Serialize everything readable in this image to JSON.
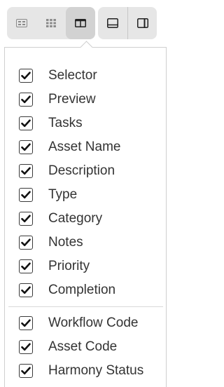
{
  "toolbar": {
    "view_buttons": [
      {
        "icon": "card-view-icon",
        "active": false
      },
      {
        "icon": "grid-view-icon",
        "active": false
      },
      {
        "icon": "column-view-icon",
        "active": true
      }
    ],
    "layout_buttons": [
      {
        "icon": "panel-bottom-icon"
      },
      {
        "icon": "panel-right-icon"
      }
    ]
  },
  "columns": {
    "group1": [
      {
        "label": "Selector",
        "checked": true
      },
      {
        "label": "Preview",
        "checked": true
      },
      {
        "label": "Tasks",
        "checked": true
      },
      {
        "label": "Asset Name",
        "checked": true
      },
      {
        "label": "Description",
        "checked": true
      },
      {
        "label": "Type",
        "checked": true
      },
      {
        "label": "Category",
        "checked": true
      },
      {
        "label": "Notes",
        "checked": true
      },
      {
        "label": "Priority",
        "checked": true
      },
      {
        "label": "Completion",
        "checked": true
      }
    ],
    "group2": [
      {
        "label": "Workflow Code",
        "checked": true
      },
      {
        "label": "Asset Code",
        "checked": true
      },
      {
        "label": "Harmony Status",
        "checked": true
      }
    ]
  }
}
